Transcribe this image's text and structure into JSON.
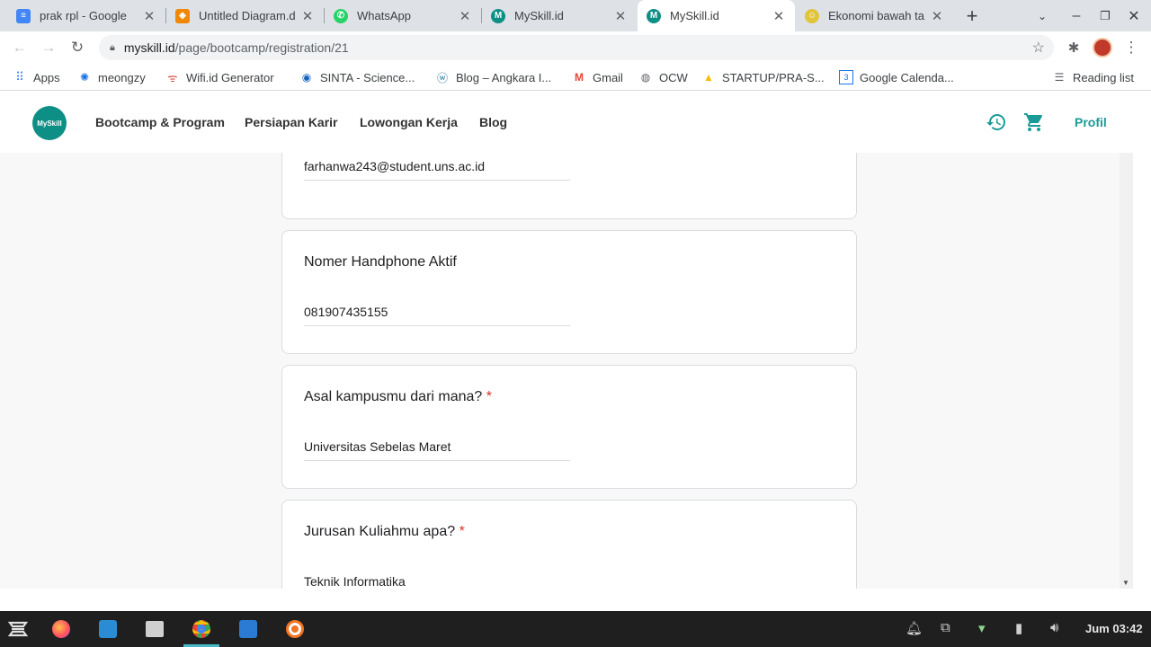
{
  "tabs": [
    {
      "title": "prak rpl - Google",
      "favicon_color": "#4285f4",
      "favicon_glyph": "≡"
    },
    {
      "title": "Untitled Diagram.d",
      "favicon_color": "#f08705",
      "favicon_glyph": "◈"
    },
    {
      "title": "WhatsApp",
      "favicon_color": "#25d366",
      "favicon_glyph": "✆"
    },
    {
      "title": "MySkill.id",
      "favicon_color": "#0d8f86",
      "favicon_glyph": "M"
    },
    {
      "title": "MySkill.id",
      "favicon_color": "#0d8f86",
      "favicon_glyph": "M"
    },
    {
      "title": "Ekonomi bawah ta",
      "favicon_color": "#e0c43a",
      "favicon_glyph": "☺"
    }
  ],
  "address": {
    "host": "myskill.id",
    "path": "/page/bootcamp/registration/21"
  },
  "bookmarks": [
    {
      "label": "Apps",
      "icon": "apps-icon"
    },
    {
      "label": "meongzy",
      "icon": "gear-icon"
    },
    {
      "label": "Wifi.id Generator",
      "icon": "wifi-icon"
    },
    {
      "label": "SINTA - Science...",
      "icon": "sinta-icon"
    },
    {
      "label": "Blog – Angkara I...",
      "icon": "wordpress-icon"
    },
    {
      "label": "Gmail",
      "icon": "gmail-icon"
    },
    {
      "label": "OCW",
      "icon": "globe-icon"
    },
    {
      "label": "STARTUP/PRA-S...",
      "icon": "drive-icon"
    },
    {
      "label": "Google Calenda...",
      "icon": "calendar-icon"
    }
  ],
  "reading_list": "Reading list",
  "site": {
    "logo": "MySkill",
    "nav": [
      "Bootcamp & Program",
      "Persiapan Karir",
      "Lowongan Kerja",
      "Blog"
    ],
    "profile": "Profil",
    "accent": "#1a9b97"
  },
  "form": {
    "email_value": "farhanwa243@student.uns.ac.id",
    "cards": [
      {
        "question": "Nomer Handphone Aktif",
        "required": "",
        "value": "081907435155"
      },
      {
        "question": "Asal kampusmu dari mana?",
        "required": "*",
        "value": "Universitas Sebelas Maret"
      },
      {
        "question": "Jurusan Kuliahmu apa?",
        "required": "*",
        "value": "Teknik Informatika"
      }
    ]
  },
  "taskbar": {
    "clock": "Jum 03:42"
  }
}
